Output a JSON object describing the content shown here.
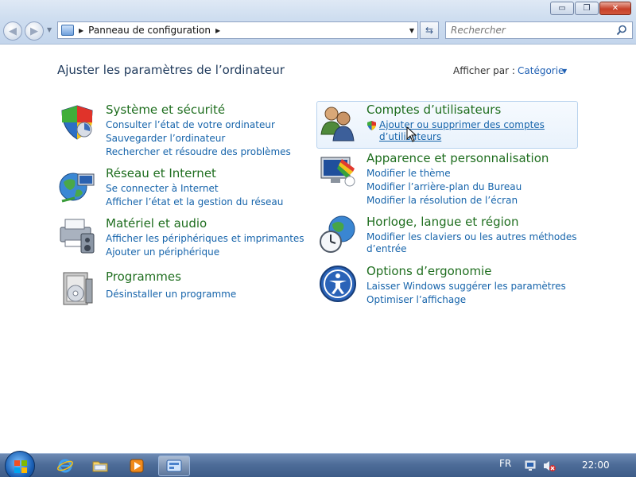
{
  "window": {
    "buttons": {
      "minimize": "▭",
      "maximize": "❐",
      "close": "✕"
    }
  },
  "nav": {
    "back_glyph": "◀",
    "forward_glyph": "▶",
    "breadcrumb": "Panneau de configuration",
    "refresh_glyph": "⇆"
  },
  "search": {
    "placeholder": "Rechercher"
  },
  "header": {
    "title": "Ajuster les paramètres de l’ordinateur",
    "view_by_label": "Afficher par :",
    "view_by_value": "Catégorie"
  },
  "categories": [
    {
      "title": "Système et sécurité",
      "icon": "shield-icon",
      "links": [
        "Consulter l’état de votre ordinateur",
        "Sauvegarder l’ordinateur",
        "Rechercher et résoudre des problèmes"
      ]
    },
    {
      "title": "Réseau et Internet",
      "icon": "network-globe-icon",
      "links": [
        "Se connecter à Internet",
        "Afficher l’état et la gestion du réseau"
      ]
    },
    {
      "title": "Matériel et audio",
      "icon": "printer-icon",
      "links": [
        "Afficher les périphériques et imprimantes",
        "Ajouter un périphérique"
      ]
    },
    {
      "title": "Programmes",
      "icon": "programs-icon",
      "links": [
        "Désinstaller un programme"
      ]
    },
    {
      "title": "Comptes d’utilisateurs",
      "icon": "users-icon",
      "links": [
        "Ajouter ou supprimer des comptes",
        "d’utilisateurs"
      ]
    },
    {
      "title": "Apparence et personnalisation",
      "icon": "monitor-paint-icon",
      "links": [
        "Modifier le thème",
        "Modifier l’arrière-plan du Bureau",
        "Modifier la résolution de l’écran"
      ]
    },
    {
      "title": "Horloge, langue et région",
      "icon": "clock-globe-icon",
      "links": [
        "Modifier les claviers ou les autres méthodes",
        "d’entrée"
      ]
    },
    {
      "title": "Options d’ergonomie",
      "icon": "accessibility-icon",
      "links": [
        "Laisser Windows suggérer les paramètres",
        "Optimiser l’affichage"
      ]
    }
  ],
  "taskbar": {
    "language": "FR",
    "clock": "22:00"
  },
  "colors": {
    "category_title": "#1f6e1f",
    "link": "#1664ab",
    "header": "#1e395b"
  }
}
